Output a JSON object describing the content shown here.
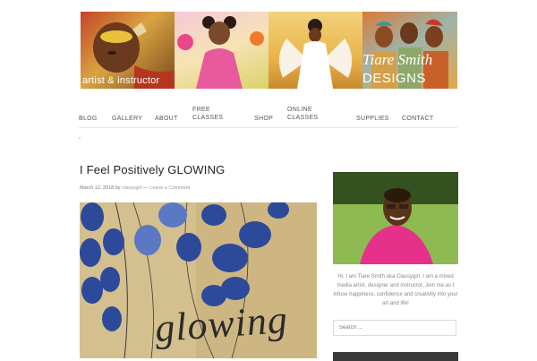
{
  "header": {
    "tagline": "artist & instructor",
    "brand_name": "Tiare Smith",
    "brand_suffix": "DESIGNS"
  },
  "nav": {
    "items": [
      {
        "label": "BLOG"
      },
      {
        "label": "GALLERY"
      },
      {
        "label": "ABOUT"
      },
      {
        "label": "FREE CLASSES"
      },
      {
        "label": "SHOP"
      },
      {
        "label": "ONLINE CLASSES"
      },
      {
        "label": "SUPPLIES"
      },
      {
        "label": "CONTACT"
      }
    ],
    "sub_arrow": "‹"
  },
  "post": {
    "title": "I Feel Positively GLOWING",
    "date": "March 12, 2018",
    "by": "by",
    "author": "classygirl",
    "separator": "—",
    "comment_link": "Leave a Comment",
    "image_text": "glowing"
  },
  "sidebar": {
    "bio": "Hi, I am Tiare Smith aka Classygirl. I am a mixed media artist, designer and instructor. Join me as I infuse happiness, confidence and creativity into your art and life!",
    "search_placeholder": "Search ..."
  },
  "colors": {
    "nav_text": "#555555",
    "meta_text": "#777777",
    "bio_text": "#888888",
    "title_text": "#222222",
    "divider": "#e6e6e6"
  }
}
